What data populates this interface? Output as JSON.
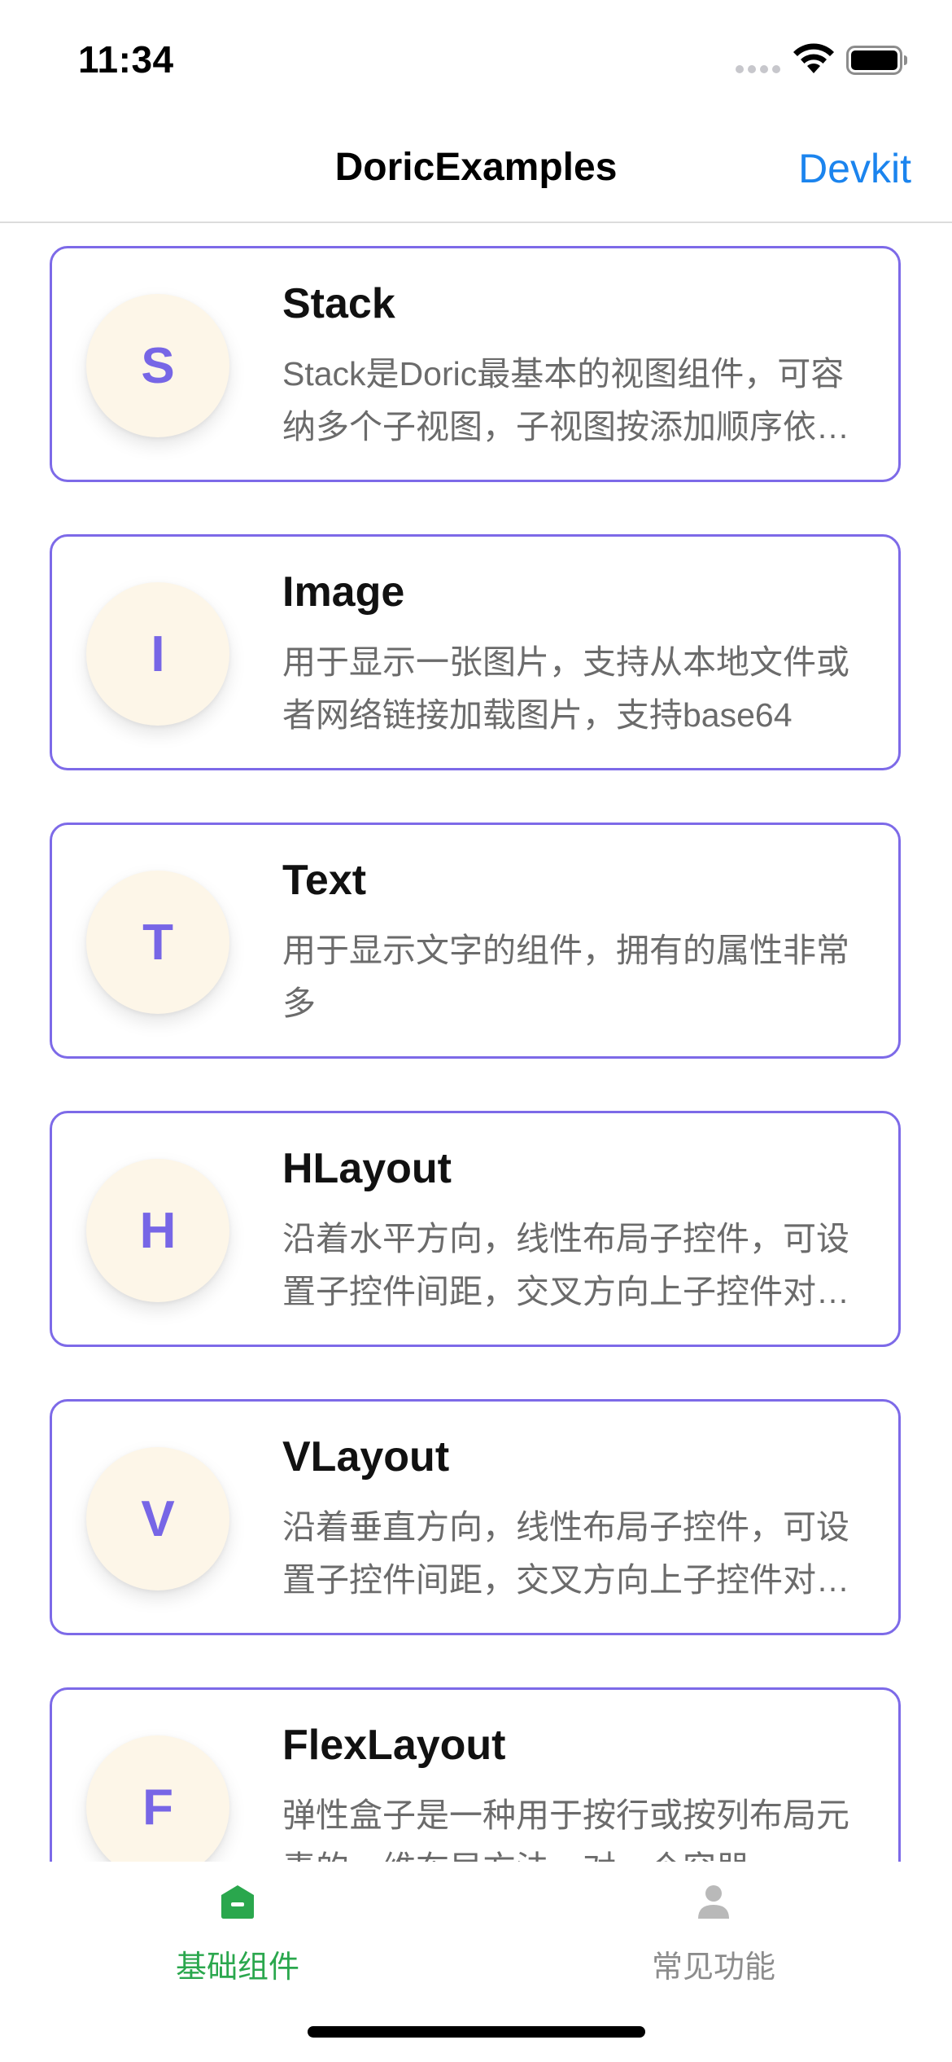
{
  "status_bar": {
    "time": "11:34"
  },
  "nav": {
    "title": "DoricExamples",
    "right_action": "Devkit"
  },
  "colors": {
    "accent_purple": "#7d6ae8",
    "link_blue": "#1b84ee",
    "tab_active_green": "#2aa74d",
    "tab_inactive_gray": "#8c8c8c",
    "avatar_bg": "#fdf6e8"
  },
  "items": [
    {
      "letter": "S",
      "title": "Stack",
      "desc": "Stack是Doric最基本的视图组件，可容纳多个子视图，子视图按添加顺序依次叠加"
    },
    {
      "letter": "I",
      "title": "Image",
      "desc": "用于显示一张图片，支持从本地文件或者网络链接加载图片，支持base64"
    },
    {
      "letter": "T",
      "title": "Text",
      "desc": "用于显示文字的组件，拥有的属性非常多"
    },
    {
      "letter": "H",
      "title": "HLayout",
      "desc": "沿着水平方向，线性布局子控件，可设置子控件间距，交叉方向上子控件对齐方式"
    },
    {
      "letter": "V",
      "title": "VLayout",
      "desc": "沿着垂直方向，线性布局子控件，可设置子控件间距，交叉方向上子控件对齐方式"
    },
    {
      "letter": "F",
      "title": "FlexLayout",
      "desc": "弹性盒子是一种用于按行或按列布局元素的一维布局方法，对一个容器"
    }
  ],
  "tabs": [
    {
      "label": "基础组件",
      "icon": "home-icon",
      "active": true
    },
    {
      "label": "常见功能",
      "icon": "person-icon",
      "active": false
    }
  ]
}
